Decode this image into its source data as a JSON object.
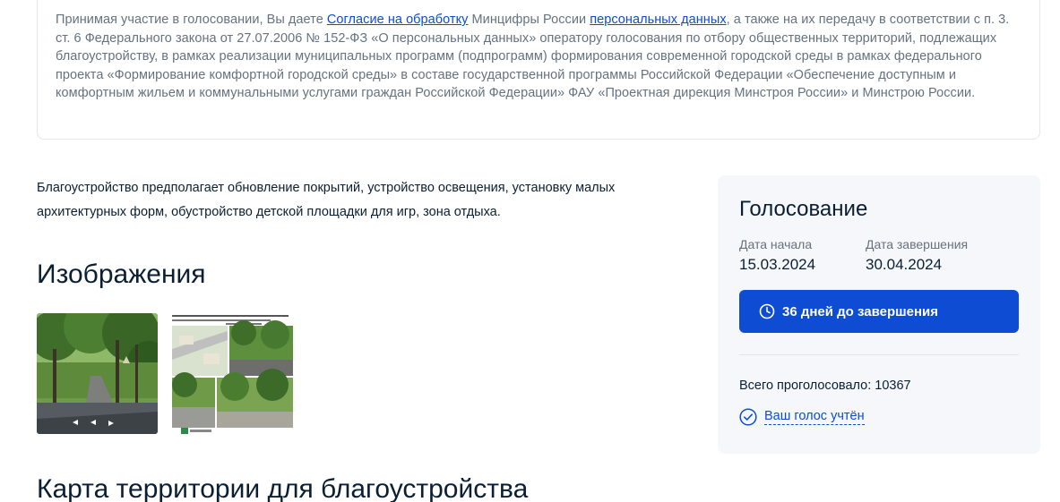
{
  "consent": {
    "part1": "Принимая участие в голосовании, Вы даете ",
    "link1": "Согласие на обработку",
    "part2": " Минцифры России ",
    "link2": "персональных данных",
    "part3": ", а также на их передачу в соответствии с п. 3. ст. 6 Федерального закона от 27.07.2006 № 152-ФЗ «О персональных данных» оператору голосования по отбору общественных территорий, подлежащих благоустройству, в рамках реализации муниципальных программ (подпрограмм) формирования современной городской среды в рамках федерального проекта «Формирование комфортной городской среды» в составе государственной программы Российской Федерации «Обеспечение доступным и комфортным жильем и коммунальными услугами граждан Российской Федерации» ФАУ «Проектная дирекция Минстроя России» и Минстрою России."
  },
  "description": "Благоустройство предполагает обновление покрытий, устройство освещения, установку малых архитектурных форм, обустройство детской площадки для игр, зона отдыха.",
  "images": {
    "heading": "Изображения",
    "items": [
      {
        "icon": "park-photo"
      },
      {
        "icon": "project-collage"
      }
    ]
  },
  "map": {
    "heading": "Карта территории для благоустройства"
  },
  "voting": {
    "title": "Голосование",
    "start_label": "Дата начала",
    "start_date": "15.03.2024",
    "end_label": "Дата завершения",
    "end_date": "30.04.2024",
    "deadline_button": "36 дней до завершения",
    "total_votes": "Всего проголосовало: 10367",
    "vote_status": "Ваш голос учтён"
  },
  "colors": {
    "accent": "#0d4cd3",
    "text": "#0b1f33",
    "muted": "#66727f",
    "card_bg": "#f5f7fa"
  }
}
